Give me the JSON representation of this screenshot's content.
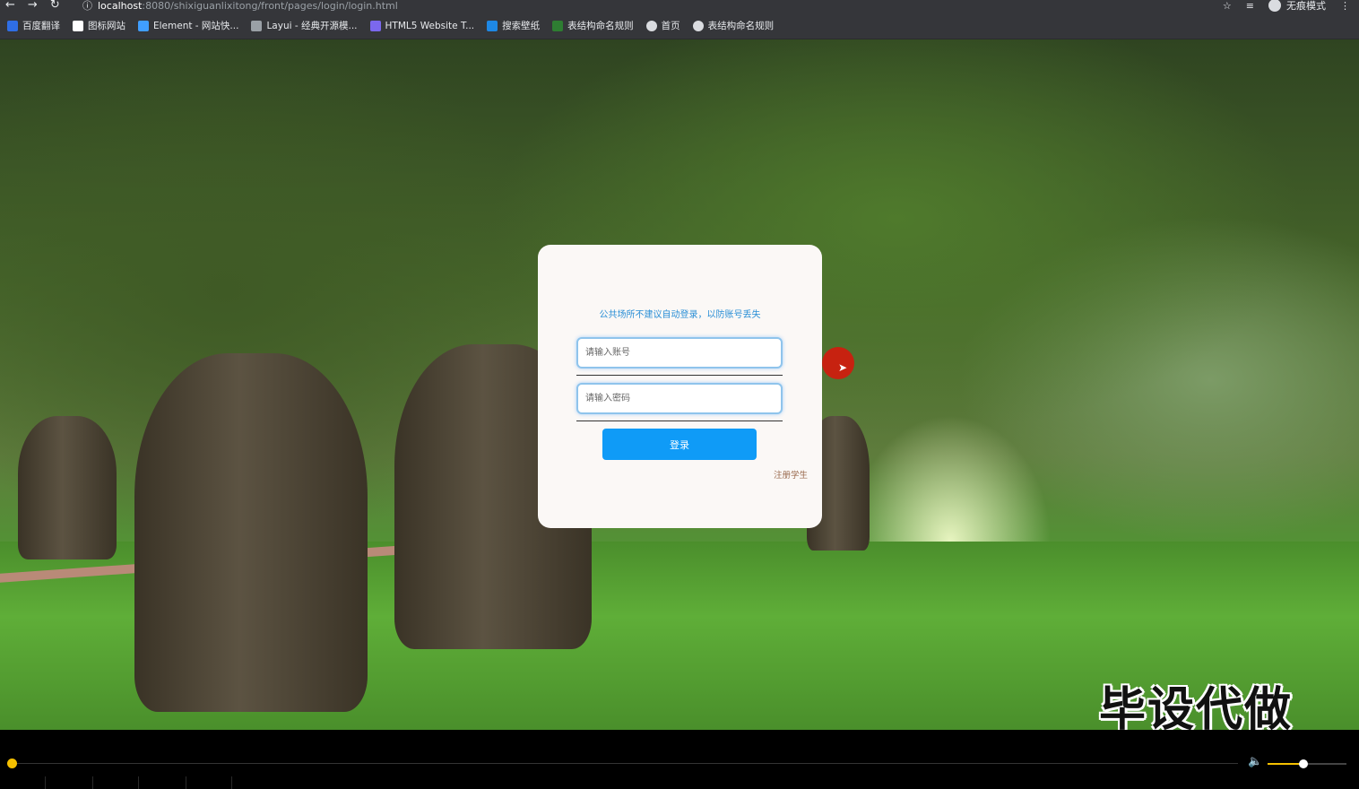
{
  "browser": {
    "url_host": "localhost",
    "url_path": ":8080/shixiguanlixitong/front/pages/login/login.html",
    "profile_label": "无痕模式",
    "bookmarks": [
      {
        "label": "百度翻译",
        "color": "#2f6ee5"
      },
      {
        "label": "图标网站",
        "color": "#ffffff"
      },
      {
        "label": "Element - 网站快...",
        "color": "#409eff"
      },
      {
        "label": "Layui - 经典开源模...",
        "color": "#9aa0a6"
      },
      {
        "label": "HTML5 Website T...",
        "color": "#7b68ee"
      },
      {
        "label": "搜索壁纸",
        "color": "#1e88e5"
      },
      {
        "label": "表结构命名规则",
        "color": "#2e7d32"
      },
      {
        "label": "首页",
        "color": "#dadce0"
      },
      {
        "label": "表结构命名规则",
        "color": "#dadce0"
      }
    ]
  },
  "login": {
    "tip": "公共场所不建议自动登录，以防账号丢失",
    "account_placeholder": "请输入账号",
    "password_placeholder": "请输入密码",
    "login_button": "登录",
    "register_link": "注册学生"
  },
  "overlay": {
    "watermark": "毕设代做"
  },
  "player": {
    "progress": 0.0,
    "volume": 0.45,
    "accent_color": "#f5c000"
  }
}
